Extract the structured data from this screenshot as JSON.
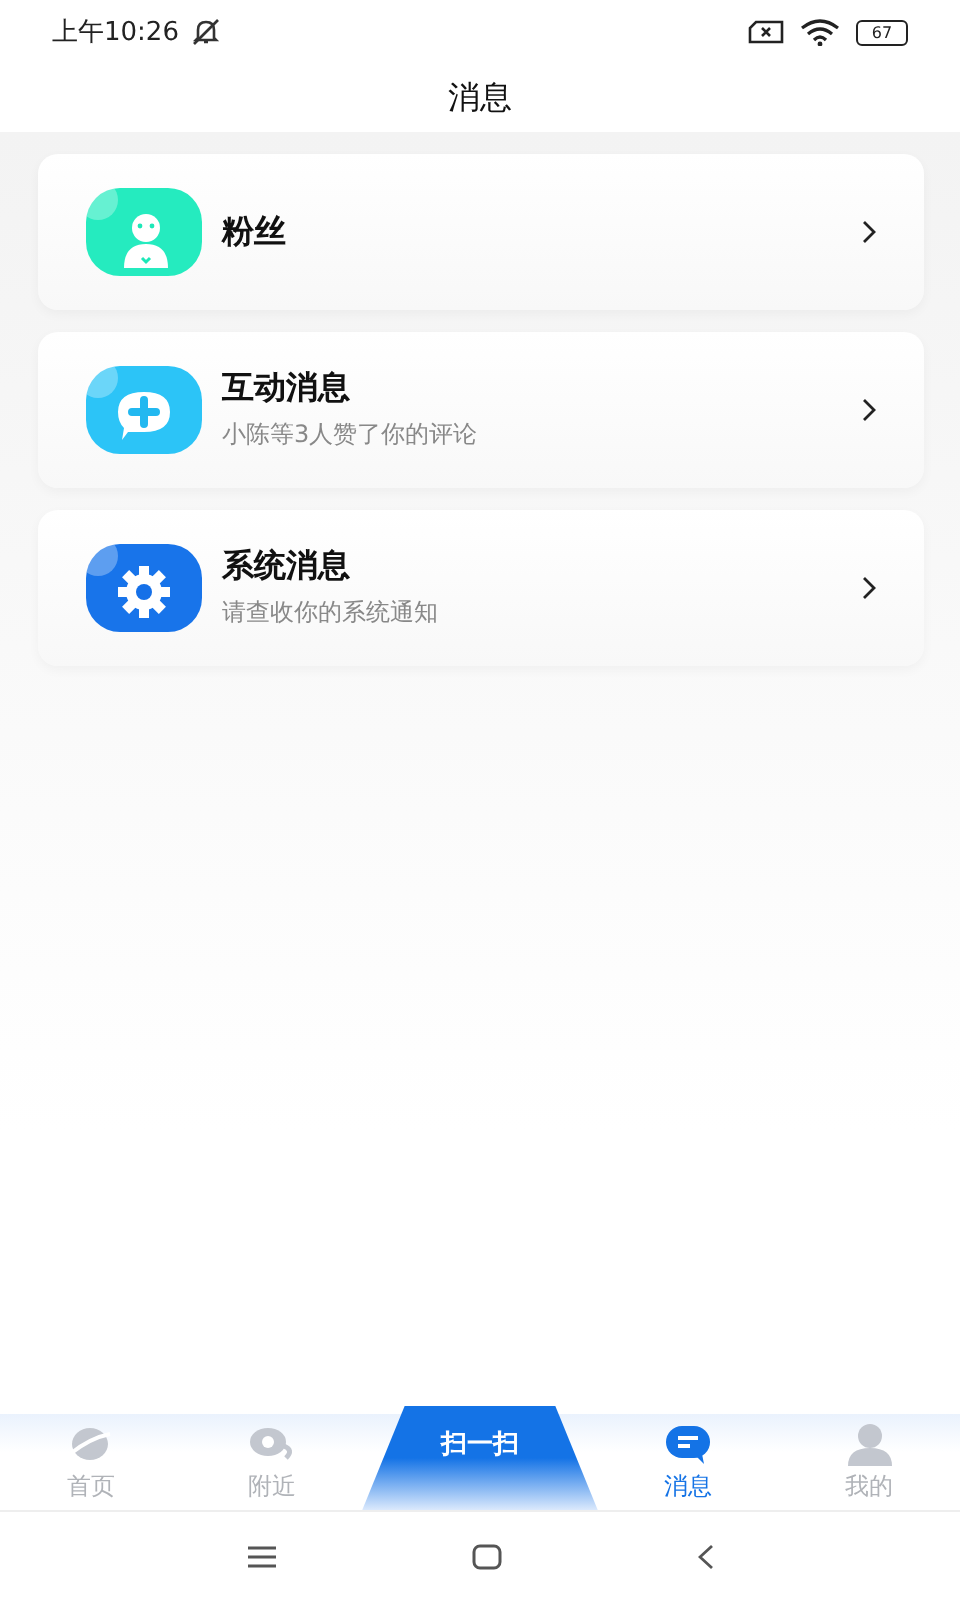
{
  "status_bar": {
    "time": "上午10:26",
    "battery": "67"
  },
  "header": {
    "title": "消息"
  },
  "items": [
    {
      "kind": "fans",
      "title": "粉丝"
    },
    {
      "kind": "interact",
      "title": "互动消息",
      "subtitle": "小陈等3人赞了你的评论"
    },
    {
      "kind": "system",
      "title": "系统消息",
      "subtitle": "请查收你的系统通知"
    }
  ],
  "tabs": [
    {
      "kind": "home",
      "label": "首页",
      "selected": false
    },
    {
      "kind": "nearby",
      "label": "附近",
      "selected": false
    },
    {
      "kind": "scan",
      "label": "扫一扫",
      "selected": false
    },
    {
      "kind": "messages",
      "label": "消息",
      "selected": true
    },
    {
      "kind": "me",
      "label": "我的",
      "selected": false
    }
  ]
}
